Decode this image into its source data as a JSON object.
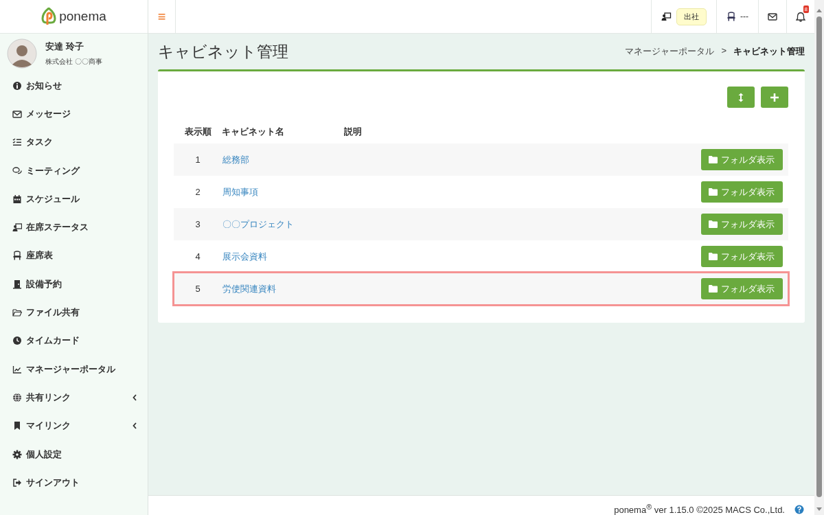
{
  "header": {
    "logo": "ponema",
    "menu_glyph": "≡",
    "attendance_status": "出社",
    "seat": "---",
    "notification_count": "8"
  },
  "user": {
    "name": "安達 玲子",
    "company": "株式会社 〇〇商事"
  },
  "sidebar": {
    "items": [
      {
        "label": "お知らせ",
        "submenu": false
      },
      {
        "label": "メッセージ",
        "submenu": false
      },
      {
        "label": "タスク",
        "submenu": false
      },
      {
        "label": "ミーティング",
        "submenu": false
      },
      {
        "label": "スケジュール",
        "submenu": false
      },
      {
        "label": "在席ステータス",
        "submenu": false
      },
      {
        "label": "座席表",
        "submenu": false
      },
      {
        "label": "設備予約",
        "submenu": false
      },
      {
        "label": "ファイル共有",
        "submenu": false
      },
      {
        "label": "タイムカード",
        "submenu": false
      },
      {
        "label": "マネージャーポータル",
        "submenu": false
      },
      {
        "label": "共有リンク",
        "submenu": true
      },
      {
        "label": "マイリンク",
        "submenu": true
      },
      {
        "label": "個人設定",
        "submenu": false
      },
      {
        "label": "サインアウト",
        "submenu": false
      }
    ]
  },
  "page": {
    "title": "キャビネット管理",
    "breadcrumb": [
      "マネージャーポータル",
      "キャビネット管理"
    ],
    "breadcrumb_separator": ">"
  },
  "table": {
    "columns": [
      "表示順",
      "キャビネット名",
      "説明"
    ],
    "rows": [
      {
        "order": "1",
        "name": "総務部",
        "button": "フォルダ表示",
        "highlighted": false
      },
      {
        "order": "2",
        "name": "周知事項",
        "button": "フォルダ表示",
        "highlighted": false
      },
      {
        "order": "3",
        "name": "〇〇プロジェクト",
        "button": "フォルダ表示",
        "highlighted": false
      },
      {
        "order": "4",
        "name": "展示会資料",
        "button": "フォルダ表示",
        "highlighted": false
      },
      {
        "order": "5",
        "name": "労使関連資料",
        "button": "フォルダ表示",
        "highlighted": true
      }
    ]
  },
  "footer": {
    "text": "ponema$^{®}$ ver 1.15.0 ©2025 MACS Co.,Ltd."
  }
}
